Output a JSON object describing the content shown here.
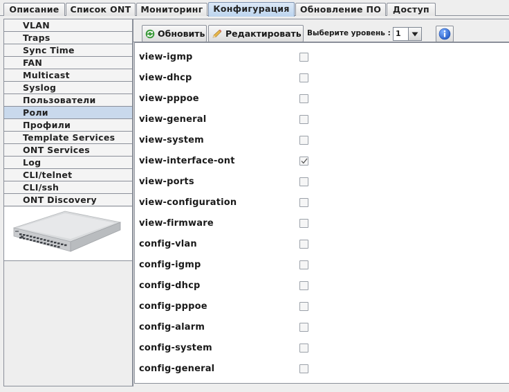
{
  "tabs": [
    {
      "label": "Описание",
      "active": false
    },
    {
      "label": "Список ONT",
      "active": false
    },
    {
      "label": "Мониторинг",
      "active": false
    },
    {
      "label": "Конфигурация",
      "active": true
    },
    {
      "label": "Обновление ПО",
      "active": false
    },
    {
      "label": "Доступ",
      "active": false
    }
  ],
  "sidebar": {
    "items": [
      {
        "label": "VLAN"
      },
      {
        "label": "Traps"
      },
      {
        "label": "Sync Time"
      },
      {
        "label": "FAN"
      },
      {
        "label": "Multicast"
      },
      {
        "label": "Syslog"
      },
      {
        "label": "Пользователи"
      },
      {
        "label": "Роли",
        "selected": true
      },
      {
        "label": "Профили"
      },
      {
        "label": "Template Services"
      },
      {
        "label": "ONT Services"
      },
      {
        "label": "Log"
      },
      {
        "label": "CLI/telnet"
      },
      {
        "label": "CLI/ssh"
      },
      {
        "label": "ONT Discovery"
      }
    ]
  },
  "toolbar": {
    "refresh_label": "Обновить",
    "edit_label": "Редактировать",
    "level_label": "Выберите уровень :",
    "level_value": "1"
  },
  "icons": {
    "refresh": "refresh-icon",
    "edit": "pencil-icon",
    "info": "info-icon",
    "dropdown": "chevron-down-icon",
    "device": "olt-device-image"
  },
  "colors": {
    "selected_nav": "#c9d9ec",
    "active_tab": "#bcd4ee",
    "info_blue": "#2f6fd6",
    "refresh_green": "#3b9a3b"
  },
  "permissions": [
    {
      "name": "view-igmp",
      "checked": false
    },
    {
      "name": "view-dhcp",
      "checked": false
    },
    {
      "name": "view-pppoe",
      "checked": false
    },
    {
      "name": "view-general",
      "checked": false
    },
    {
      "name": "view-system",
      "checked": false
    },
    {
      "name": "view-interface-ont",
      "checked": true
    },
    {
      "name": "view-ports",
      "checked": false
    },
    {
      "name": "view-configuration",
      "checked": false
    },
    {
      "name": "view-firmware",
      "checked": false
    },
    {
      "name": "config-vlan",
      "checked": false
    },
    {
      "name": "config-igmp",
      "checked": false
    },
    {
      "name": "config-dhcp",
      "checked": false
    },
    {
      "name": "config-pppoe",
      "checked": false
    },
    {
      "name": "config-alarm",
      "checked": false
    },
    {
      "name": "config-system",
      "checked": false
    },
    {
      "name": "config-general",
      "checked": false
    }
  ]
}
